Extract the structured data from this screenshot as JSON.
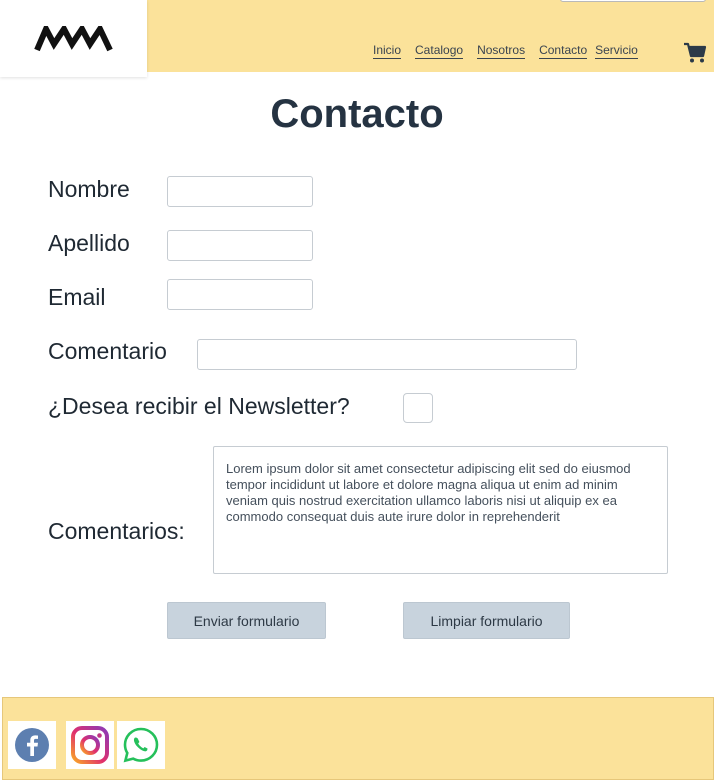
{
  "header": {
    "logo_text": "MW",
    "nav": [
      "Inicio",
      "Catalogo",
      "Nosotros",
      "Contacto",
      "Servicio"
    ],
    "cart_icon": "cart-icon"
  },
  "form": {
    "title": "Contacto",
    "nombre_label": "Nombre",
    "apellido_label": "Apellido",
    "email_label": "Email",
    "comentario_label": "Comentario",
    "newsletter_label": "¿Desea recibir el Newsletter?",
    "comentarios_label": "Comentarios:",
    "comentarios_value": "Lorem ipsum dolor sit amet consectetur adipiscing elit sed do eiusmod tempor incididunt ut labore et dolore magna aliqua ut enim ad minim veniam quis nostrud exercitation ullamco laboris nisi ut aliquip ex ea commodo consequat duis aute irure dolor in reprehenderit",
    "submit_label": "Enviar formulario",
    "reset_label": "Limpiar formulario"
  },
  "footer": {
    "social": [
      "facebook-icon",
      "instagram-icon",
      "whatsapp-icon"
    ]
  },
  "colors": {
    "header_bg": "#fbe29a",
    "title": "#253342",
    "button_bg": "#c8d3dd"
  }
}
